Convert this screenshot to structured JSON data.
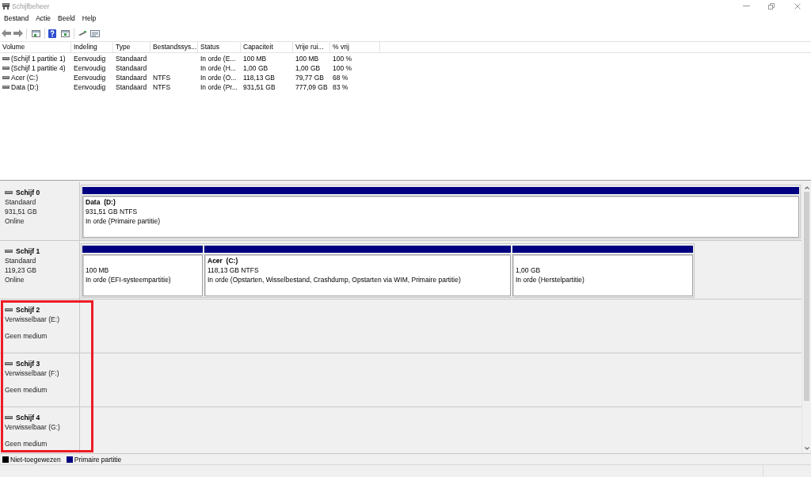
{
  "window": {
    "title": "Schijfbeheer"
  },
  "menu": [
    "Bestand",
    "Actie",
    "Beeld",
    "Help"
  ],
  "volume_table": {
    "columns": [
      "Volume",
      "Indeling",
      "Type",
      "Bestandssys...",
      "Status",
      "Capaciteit",
      "Vrije rui...",
      "% vrij"
    ],
    "rows": [
      {
        "volume": "(Schijf 1 partitie 1)",
        "layout": "Eenvoudig",
        "type": "Standaard",
        "status": "In orde (E...",
        "capacity": "100 MB",
        "free_space": "100 MB",
        "percent_free": "100 %"
      },
      {
        "volume": "(Schijf 1 partitie 4)",
        "layout": "Eenvoudig",
        "type": "Standaard",
        "status": "In orde (H...",
        "capacity": "1,00 GB",
        "free_space": "1,00 GB",
        "percent_free": "100 %"
      },
      {
        "volume": "Acer (C:)",
        "layout": "Eenvoudig",
        "type": "Standaard",
        "file_system": "NTFS",
        "status": "In orde (O...",
        "capacity": "118,13 GB",
        "free_space": "79,77 GB",
        "percent_free": "68 %"
      },
      {
        "volume": "Data (D:)",
        "layout": "Eenvoudig",
        "type": "Standaard",
        "file_system": "NTFS",
        "status": "In orde (Pr...",
        "capacity": "931,51 GB",
        "free_space": "777,09 GB",
        "percent_free": "83 %"
      }
    ]
  },
  "disks": [
    {
      "name": "Schijf 0",
      "kind": "basic",
      "type": "Standaard",
      "capacity": "931,51 GB",
      "state": "Online",
      "partitions": [
        {
          "name": "Data  (D:)",
          "size": "931,51 GB NTFS",
          "status": "In orde (Primaire partitie)",
          "color": "#000080"
        }
      ]
    },
    {
      "name": "Schijf 1",
      "kind": "basic",
      "type": "Standaard",
      "capacity": "119,23 GB",
      "state": "Online",
      "partitions": [
        {
          "size": "100 MB",
          "status": "In orde (EFI-systeempartitie)",
          "color": "#000080"
        },
        {
          "name": "Acer  (C:)",
          "size": "118,13 GB NTFS",
          "status": "In orde (Opstarten, Wisselbestand, Crashdump, Opstarten via WIM, Primaire partitie)",
          "color": "#000080"
        },
        {
          "size": "1,00 GB",
          "status": "In orde (Herstelpartitie)",
          "color": "#000080"
        }
      ]
    },
    {
      "name": "Schijf 2",
      "kind": "removable",
      "type": "Verwisselbaar (E:)",
      "state": "Geen medium"
    },
    {
      "name": "Schijf 3",
      "kind": "removable",
      "type": "Verwisselbaar (F:)",
      "state": "Geen medium"
    },
    {
      "name": "Schijf 4",
      "kind": "removable",
      "type": "Verwisselbaar (G:)",
      "state": "Geen medium"
    }
  ],
  "legend": [
    {
      "label": "Niet-toegewezen",
      "color": "#000000"
    },
    {
      "label": "Primaire partitie",
      "color": "#000080"
    }
  ]
}
